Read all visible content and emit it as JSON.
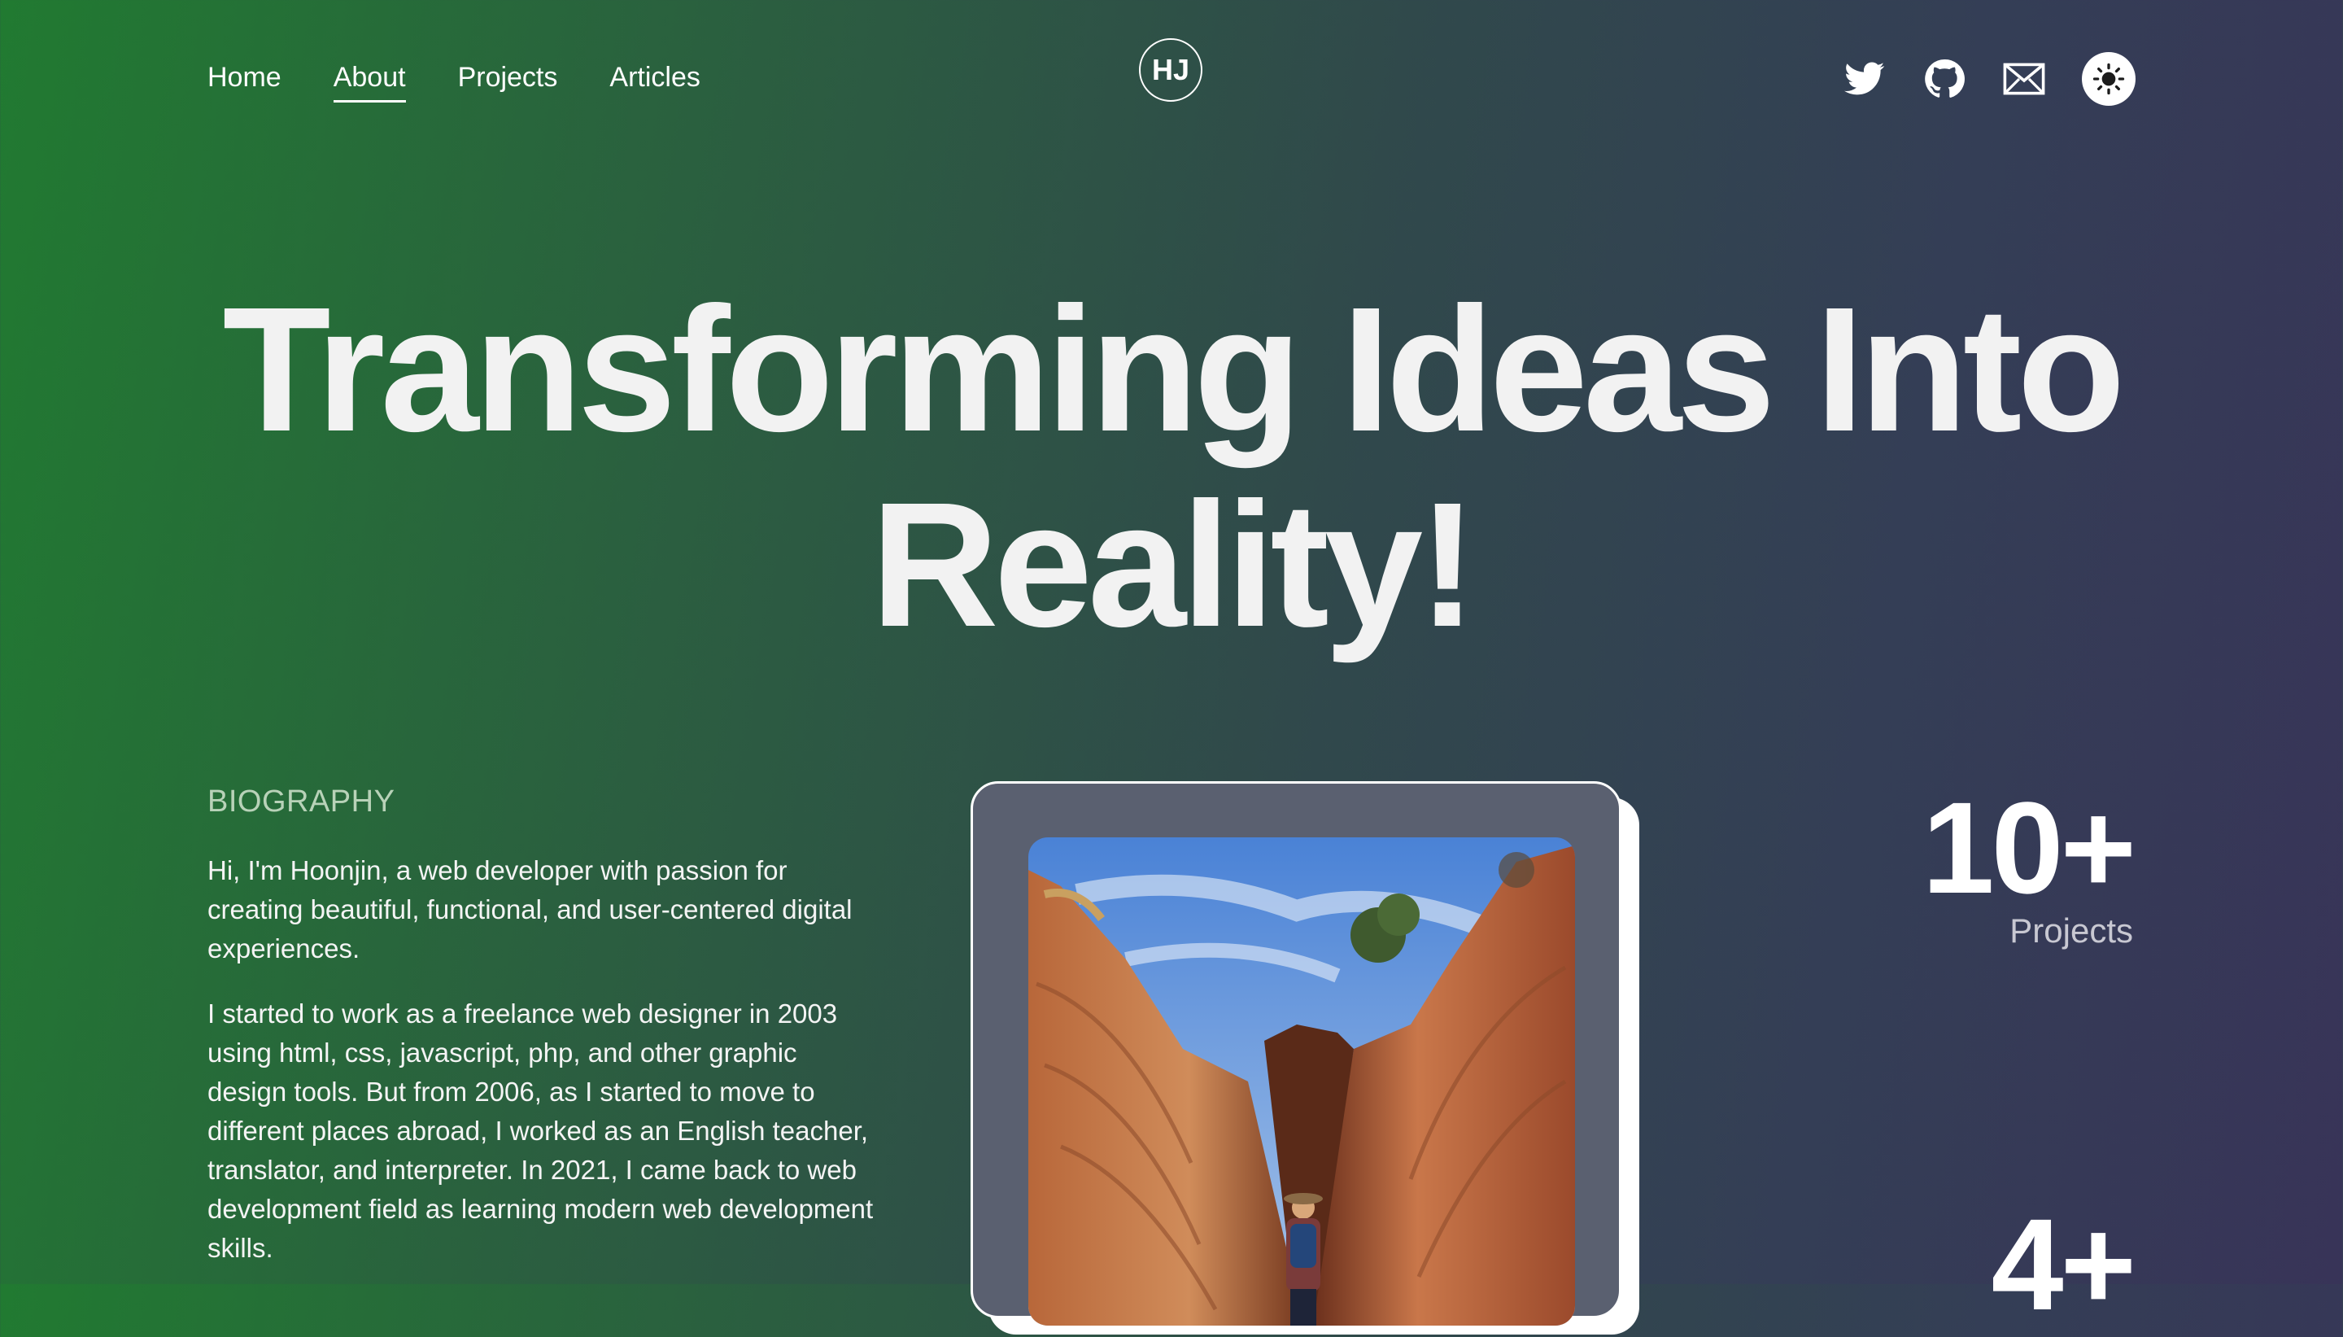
{
  "nav": {
    "items": [
      {
        "label": "Home"
      },
      {
        "label": "About"
      },
      {
        "label": "Projects"
      },
      {
        "label": "Articles"
      }
    ],
    "active": "About"
  },
  "logo": {
    "text": "HJ"
  },
  "social": {
    "icons": [
      "twitter-icon",
      "github-icon",
      "mail-icon",
      "sun-icon"
    ]
  },
  "hero": {
    "line1": "Transforming Ideas Into",
    "line2": "Reality!"
  },
  "biography": {
    "title": "BIOGRAPHY",
    "paragraphs": [
      "Hi, I'm Hoonjin, a web developer with passion for creating beautiful, functional, and user-centered digital experiences.",
      "I started to work as a freelance web designer in 2003 using html, css, javascript, php, and other graphic design tools. But from 2006, as I started to move to different places abroad, I worked as an English teacher, translator, and interpreter. In 2021, I came back to web development field as learning modern web development skills."
    ]
  },
  "stats": [
    {
      "number": "10+",
      "label": "Projects"
    },
    {
      "number": "4+",
      "label": ""
    }
  ],
  "colors": {
    "gradient_start": "#217a31",
    "gradient_end": "#383458",
    "bio_title": "#b8d2b8",
    "card_bg": "#5a6070"
  }
}
